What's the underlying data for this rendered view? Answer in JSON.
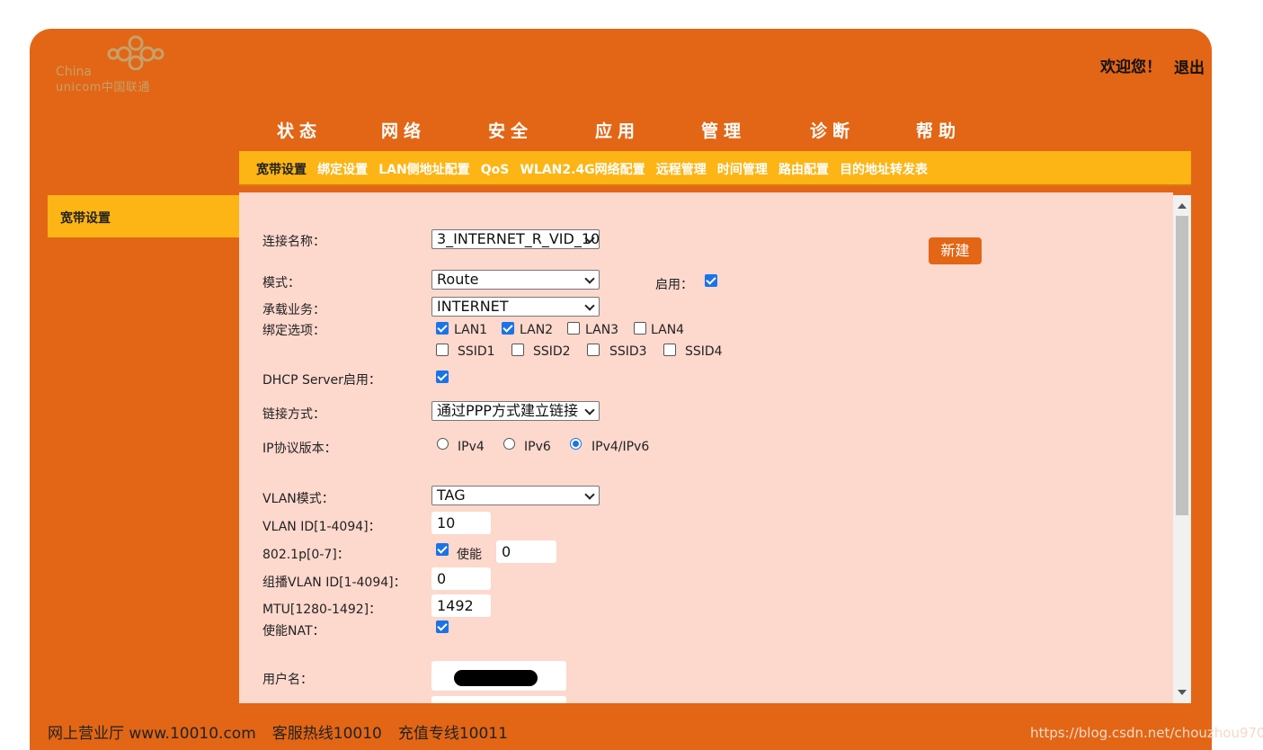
{
  "colors": {
    "frame": "#e26615",
    "subnav": "#fdb515",
    "content": "#fdd8cd",
    "checkbox": "#1a73e8"
  },
  "header": {
    "logo_text_en": "China",
    "logo_text_en2": "unicom中国联通",
    "welcome": "欢迎您！",
    "logout": "退出"
  },
  "nav": [
    "状态",
    "网络",
    "安全",
    "应用",
    "管理",
    "诊断",
    "帮助"
  ],
  "subnav": [
    "宽带设置",
    "绑定设置",
    "LAN侧地址配置",
    "QoS",
    "WLAN2.4G网络配置",
    "远程管理",
    "时间管理",
    "路由配置",
    "目的地址转发表"
  ],
  "sidebar": {
    "item": "宽带设置"
  },
  "form": {
    "connection_name_label": "连接名称：",
    "connection_name_value": "3_INTERNET_R_VID_10",
    "new_button": "新建",
    "mode_label": "模式：",
    "mode_value": "Route",
    "enable_label": "启用：",
    "service_label": "承载业务：",
    "service_value": "INTERNET",
    "bind_label": "绑定选项：",
    "bind_options": [
      {
        "label": "LAN1",
        "checked": true
      },
      {
        "label": "LAN2",
        "checked": true
      },
      {
        "label": "LAN3",
        "checked": false
      },
      {
        "label": "LAN4",
        "checked": false
      },
      {
        "label": "SSID1",
        "checked": false
      },
      {
        "label": "SSID2",
        "checked": false
      },
      {
        "label": "SSID3",
        "checked": false
      },
      {
        "label": "SSID4",
        "checked": false
      }
    ],
    "dhcp_label": "DHCP Server启用：",
    "link_label": "链接方式：",
    "link_value": "通过PPP方式建立链接",
    "ip_label": "IP协议版本：",
    "ip_options": [
      "IPv4",
      "IPv6",
      "IPv4/IPv6"
    ],
    "ip_selected": "IPv4/IPv6",
    "vlan_mode_label": "VLAN模式：",
    "vlan_mode_value": "TAG",
    "vlan_id_label": "VLAN ID[1-4094]：",
    "vlan_id_value": "10",
    "p8021_label": "802.1p[0-7]：",
    "p8021_enable": "使能",
    "p8021_value": "0",
    "mvlan_label": "组播VLAN ID[1-4094]：",
    "mvlan_value": "0",
    "mtu_label": "MTU[1280-1492]：",
    "mtu_value": "1492",
    "nat_label": "使能NAT：",
    "username_label": "用户名："
  },
  "footer": [
    "网上营业厅 www.10010.com",
    "客服热线10010",
    "充值专线10011"
  ],
  "watermark": "https://blog.csdn.net/chouzhou9701"
}
